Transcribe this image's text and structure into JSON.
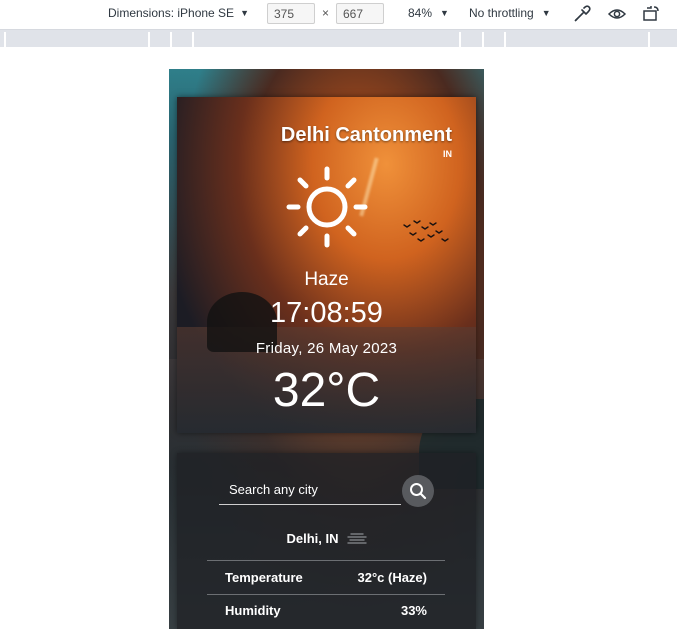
{
  "devtools": {
    "dimensions_label": "Dimensions: iPhone SE",
    "width_value": "375",
    "times_sign": "×",
    "height_value": "667",
    "zoom_label": "84%",
    "throttle_label": "No throttling"
  },
  "weather": {
    "city": "Delhi Cantonment",
    "country": "IN",
    "condition": "Haze",
    "time": "17:08:59",
    "date": "Friday, 26 May 2023",
    "temperature": "32°C"
  },
  "search": {
    "placeholder": "Search any city",
    "location": "Delhi, IN",
    "rows": [
      {
        "label": "Temperature",
        "value": "32°c (Haze)"
      },
      {
        "label": "Humidity",
        "value": "33%"
      }
    ]
  },
  "colors": {
    "accent_orange": "#e07a2a",
    "panel_dark": "#1e2024",
    "text": "#ffffff"
  },
  "icons": {
    "weather": "sun-icon",
    "birds": "birds-icon",
    "search": "search-icon",
    "condition_small": "haze-icon"
  }
}
